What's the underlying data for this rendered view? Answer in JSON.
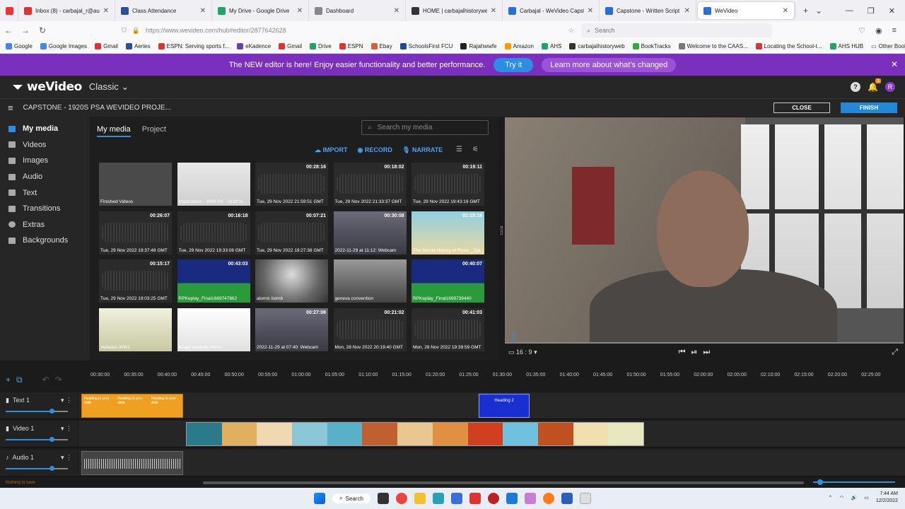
{
  "browser": {
    "tabs": [
      {
        "label": "",
        "color": "#e33"
      },
      {
        "label": "Inbox (8) - carbajal_r@auh",
        "color": "#d33"
      },
      {
        "label": "Class Attendance",
        "color": "#2a4fa0"
      },
      {
        "label": "My Drive - Google Drive",
        "color": "#1fa463"
      },
      {
        "label": "Dashboard",
        "color": "#888"
      },
      {
        "label": "HOME | carbajalhistoryweb",
        "color": "#333"
      },
      {
        "label": "Carbajal - WeVideo Capsto",
        "color": "#2a6fd8"
      },
      {
        "label": "Capstone - Written Script fo",
        "color": "#2a6fd8"
      },
      {
        "label": "WeVideo",
        "color": "#2a6fd8"
      }
    ],
    "url": "https://www.wevideo.com/hub#editor/2877642628",
    "search_placeholder": "Search",
    "bookmarks": [
      "Google",
      "Google Images",
      "Gmail",
      "Aeries",
      "ESPN: Serving sports f...",
      "eKadence",
      "Gmail",
      "Drive",
      "ESPN",
      "Ebay",
      "SchoolsFirst FCU",
      "Rajahwwfe",
      "Amazon",
      "AHS",
      "carbajalhistoryweb",
      "BookTracks",
      "Welcome to the CAAS...",
      "Locating the School-t...",
      "AHS HUB"
    ],
    "other_bookmarks": "Other Bookmarks"
  },
  "banner": {
    "text": "The NEW editor is here! Enjoy easier functionality and better performance.",
    "try_label": "Try it",
    "learn_label": "Learn more about what's changed"
  },
  "header": {
    "logo": "weVideo",
    "mode": "Classic",
    "project_title": "CAPSTONE - 1920S PSA WEVIDEO PROJE...",
    "close_label": "CLOSE",
    "finish_label": "FINISH",
    "notification_count": "1",
    "avatar_letter": "R"
  },
  "sidebar": {
    "items": [
      {
        "label": "My media"
      },
      {
        "label": "Videos"
      },
      {
        "label": "Images"
      },
      {
        "label": "Audio"
      },
      {
        "label": "Text"
      },
      {
        "label": "Transitions"
      },
      {
        "label": "Extras"
      },
      {
        "label": "Backgrounds"
      }
    ]
  },
  "media": {
    "tabs": [
      "My media",
      "Project"
    ],
    "search_placeholder": "Search my media",
    "import_label": "IMPORT",
    "record_label": "RECORD",
    "narrate_label": "NARRATE",
    "items": [
      {
        "caption": "Finished Videos",
        "duration": "",
        "kind": "folder"
      },
      {
        "caption": "Imperialism - WWI Pic - Draft N...",
        "duration": "",
        "kind": "doc"
      },
      {
        "caption": "Tue, 29 Nov 2022 21:59:51 GMT",
        "duration": "00:28:16",
        "kind": "audio"
      },
      {
        "caption": "Tue, 29 Nov 2022 21:33:37 GMT",
        "duration": "00:18:02",
        "kind": "audio"
      },
      {
        "caption": "Tue, 29 Nov 2022 19:43:19 GMT",
        "duration": "00:19:11",
        "kind": "audio"
      },
      {
        "caption": "Tue, 29 Nov 2022 19:37:48 GMT",
        "duration": "00:26:07",
        "kind": "audio"
      },
      {
        "caption": "Tue, 29 Nov 2022 19:33:08 GMT",
        "duration": "00:16:18",
        "kind": "audio"
      },
      {
        "caption": "Tue, 29 Nov 2022 19:27:38 GMT",
        "duration": "00:07:21",
        "kind": "audio"
      },
      {
        "caption": "2022-11-29 at 11:12: Webcam",
        "duration": "00:30:08",
        "kind": "webcam"
      },
      {
        "caption": "The Secret History of Pizza _ Epi...",
        "duration": "02:15:16",
        "kind": "pizza"
      },
      {
        "caption": "Tue, 29 Nov 2022 19:03:25 GMT",
        "duration": "00:15:17",
        "kind": "audio"
      },
      {
        "caption": "RPKeplay_Final1669747862",
        "duration": "00:43:03",
        "kind": "logo"
      },
      {
        "caption": "atomic bomb",
        "duration": "",
        "kind": "bomb"
      },
      {
        "caption": "geneva convention",
        "duration": "",
        "kind": "photo"
      },
      {
        "caption": "RPKeplay_Final1669739440",
        "duration": "00:40:07",
        "kind": "logo"
      },
      {
        "caption": "Vehicles WW1",
        "duration": "",
        "kind": "vehicles"
      },
      {
        "caption": "image analysis WW1",
        "duration": "",
        "kind": "table"
      },
      {
        "caption": "2022-11-29 at 07:40: Webcam",
        "duration": "00:27:08",
        "kind": "webcam"
      },
      {
        "caption": "Mon, 28 Nov 2022 20:19:40 GMT",
        "duration": "00:21:02",
        "kind": "audio"
      },
      {
        "caption": "Mon, 28 Nov 2022 19:39:59 GMT",
        "duration": "00:41:03",
        "kind": "audio"
      }
    ]
  },
  "player": {
    "aspect": "16 : 9"
  },
  "timeline": {
    "ticks": [
      "00:30:00",
      "00:35:00",
      "00:40:00",
      "00:45:00",
      "00:50:00",
      "00:55:00",
      "01:00:00",
      "01:05:00",
      "01:10:00",
      "01:15:00",
      "01:20:00",
      "01:25:00",
      "01:30:00",
      "01:35:00",
      "01:40:00",
      "01:45:00",
      "01:50:00",
      "01:55:00",
      "02:00:00",
      "02:05:00",
      "02:10:00",
      "02:15:00",
      "02:20:00",
      "02:25:00"
    ],
    "tracks": [
      {
        "name": "Text 1"
      },
      {
        "name": "Video 1"
      },
      {
        "name": "Audio 1"
      }
    ],
    "text_clip_label": "Heading to your slide",
    "heading2_label": "Heading 2",
    "status": "Nothing to save"
  },
  "taskbar": {
    "search_label": "Search",
    "time": "7:44 AM",
    "date": "12/2/2022"
  },
  "colors": {
    "accent": "#2e8fe0",
    "banner": "#7b2fbd",
    "text_clip": "#f0a020",
    "heading_clip": "#1a2fd0"
  }
}
